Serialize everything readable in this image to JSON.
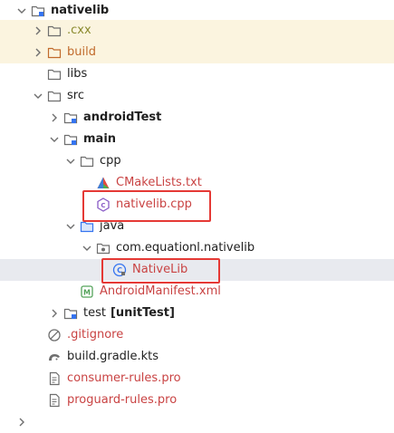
{
  "tree": {
    "nativelib": "nativelib",
    "cxx": ".cxx",
    "build": "build",
    "libs": "libs",
    "src": "src",
    "androidTest": "androidTest",
    "main": "main",
    "cpp": "cpp",
    "cmakelists": "CMakeLists.txt",
    "nativelib_cpp": "nativelib.cpp",
    "java": "java",
    "package": "com.equationl.nativelib",
    "nativelib_class": "NativeLib",
    "manifest": "AndroidManifest.xml",
    "test": "test",
    "test_suffix": "[unitTest]",
    "gitignore": ".gitignore",
    "build_gradle": "build.gradle.kts",
    "consumer_rules": "consumer-rules.pro",
    "proguard_rules": "proguard-rules.pro"
  },
  "colors": {
    "selection": "#e8eaef",
    "excluded_row": "#fbf4df",
    "highlight_box": "#e53935",
    "untracked_file": "#c94343"
  },
  "icons": [
    "folder-icon",
    "module-folder-icon",
    "cpp-file-icon",
    "cmake-icon",
    "java-folder-icon",
    "package-icon",
    "class-icon",
    "manifest-icon",
    "gitignore-icon",
    "gradle-icon",
    "file-icon"
  ]
}
